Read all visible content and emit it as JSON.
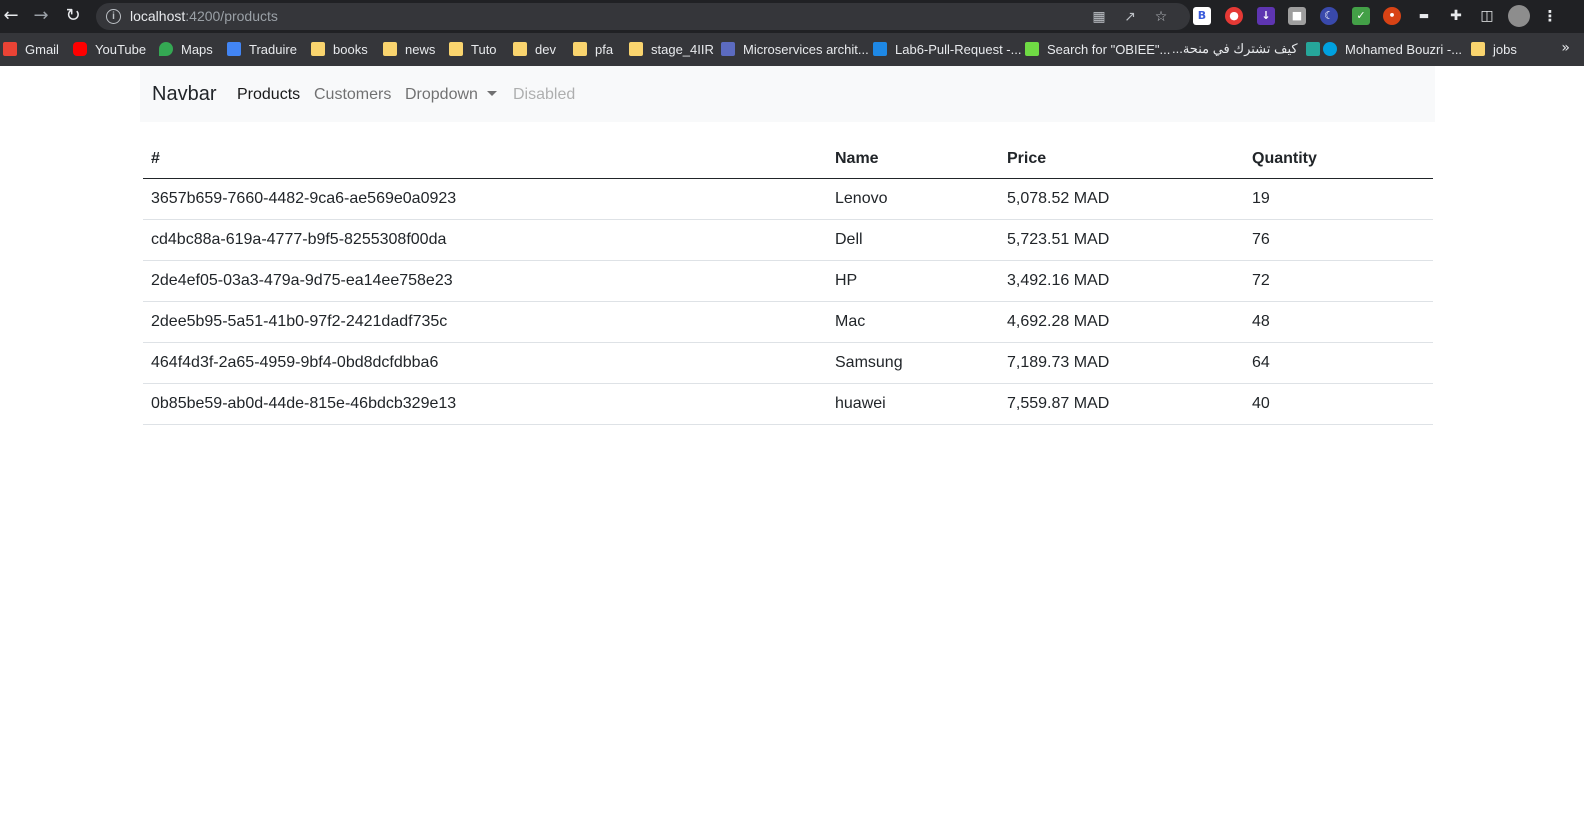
{
  "browser": {
    "url_host": "localhost",
    "url_path": ":4200/products",
    "bookmarks": [
      {
        "label": "Gmail",
        "icon": "gmail-icon"
      },
      {
        "label": "YouTube",
        "icon": "youtube-icon"
      },
      {
        "label": "Maps",
        "icon": "maps-icon"
      },
      {
        "label": "Traduire",
        "icon": "translate-icon"
      },
      {
        "label": "books",
        "icon": "folder-icon"
      },
      {
        "label": "news",
        "icon": "folder-icon"
      },
      {
        "label": "Tuto",
        "icon": "folder-icon"
      },
      {
        "label": "dev",
        "icon": "folder-icon"
      },
      {
        "label": "pfa",
        "icon": "folder-icon"
      },
      {
        "label": "stage_4IIR",
        "icon": "folder-icon"
      },
      {
        "label": "Microservices archit...",
        "icon": "site-icon"
      },
      {
        "label": "Lab6-Pull-Request -...",
        "icon": "azure-icon"
      },
      {
        "label": "Search for \"OBIEE\"...",
        "icon": "upwork-icon"
      },
      {
        "label": "كيف تشترك في منحة...",
        "icon": "site-icon"
      },
      {
        "label": "Mohamed Bouzri -...",
        "icon": "salesforce-icon"
      },
      {
        "label": "jobs",
        "icon": "folder-icon"
      }
    ]
  },
  "navbar": {
    "brand": "Navbar",
    "links": [
      {
        "label": "Products",
        "state": "active"
      },
      {
        "label": "Customers",
        "state": "normal"
      },
      {
        "label": "Dropdown",
        "state": "dropdown"
      },
      {
        "label": "Disabled",
        "state": "disabled"
      }
    ]
  },
  "table": {
    "headers": [
      "#",
      "Name",
      "Price",
      "Quantity"
    ],
    "rows": [
      {
        "id": "3657b659-7660-4482-9ca6-ae569e0a0923",
        "name": "Lenovo",
        "price": "5,078.52 MAD",
        "quantity": "19"
      },
      {
        "id": "cd4bc88a-619a-4777-b9f5-8255308f00da",
        "name": "Dell",
        "price": "5,723.51 MAD",
        "quantity": "76"
      },
      {
        "id": "2de4ef05-03a3-479a-9d75-ea14ee758e23",
        "name": "HP",
        "price": "3,492.16 MAD",
        "quantity": "72"
      },
      {
        "id": "2dee5b95-5a51-41b0-97f2-2421dadf735c",
        "name": "Mac",
        "price": "4,692.28 MAD",
        "quantity": "48"
      },
      {
        "id": "464f4d3f-2a65-4959-9bf4-0bd8dcfdbba6",
        "name": "Samsung",
        "price": "7,189.73 MAD",
        "quantity": "64"
      },
      {
        "id": "0b85be59-ab0d-44de-815e-46bdcb329e13",
        "name": "huawei",
        "price": "7,559.87 MAD",
        "quantity": "40"
      }
    ]
  }
}
